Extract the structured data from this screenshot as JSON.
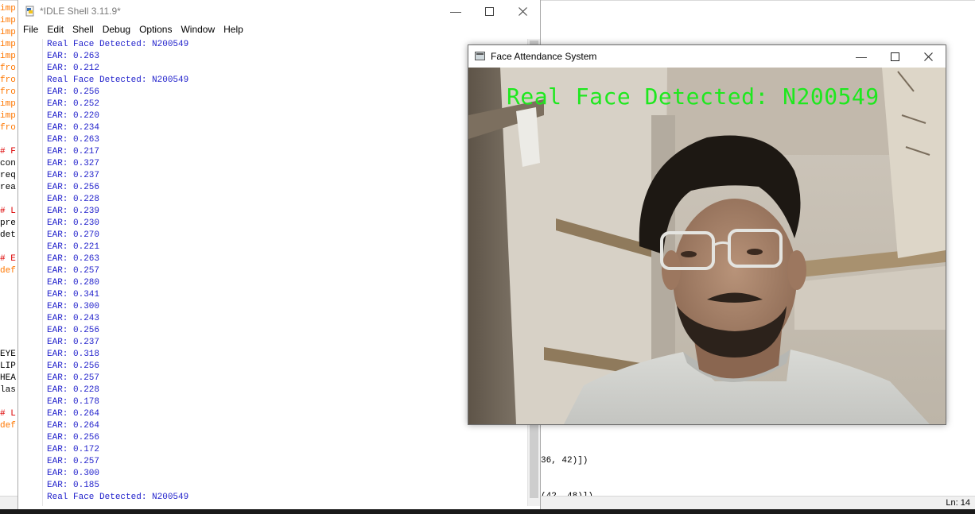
{
  "background_editor": {
    "code_lines": [
      {
        "text": "imp",
        "color": "#ff7700"
      },
      {
        "text": "imp",
        "color": "#ff7700"
      },
      {
        "text": "imp",
        "color": "#ff7700"
      },
      {
        "text": "imp",
        "color": "#ff7700"
      },
      {
        "text": "imp",
        "color": "#ff7700"
      },
      {
        "text": "fro",
        "color": "#ff7700"
      },
      {
        "text": "fro",
        "color": "#ff7700"
      },
      {
        "text": "fro",
        "color": "#ff7700"
      },
      {
        "text": "imp",
        "color": "#ff7700"
      },
      {
        "text": "imp",
        "color": "#ff7700"
      },
      {
        "text": "fro",
        "color": "#ff7700"
      },
      {
        "text": "",
        "color": "#000000"
      },
      {
        "text": "# F",
        "color": "#dd0000"
      },
      {
        "text": "con",
        "color": "#000000"
      },
      {
        "text": "req",
        "color": "#000000"
      },
      {
        "text": "rea",
        "color": "#000000"
      },
      {
        "text": "",
        "color": "#000000"
      },
      {
        "text": "# L",
        "color": "#dd0000"
      },
      {
        "text": "pre",
        "color": "#000000"
      },
      {
        "text": "det",
        "color": "#000000"
      },
      {
        "text": "",
        "color": "#000000"
      },
      {
        "text": "# E",
        "color": "#dd0000"
      },
      {
        "text": "def",
        "color": "#ff7700"
      },
      {
        "text": "",
        "color": "#000000"
      },
      {
        "text": "",
        "color": "#000000"
      },
      {
        "text": "",
        "color": "#000000"
      },
      {
        "text": "",
        "color": "#000000"
      },
      {
        "text": "",
        "color": "#000000"
      },
      {
        "text": "",
        "color": "#000000"
      },
      {
        "text": "EYE",
        "color": "#000000"
      },
      {
        "text": "LIP",
        "color": "#000000"
      },
      {
        "text": "HEA",
        "color": "#000000"
      },
      {
        "text": "las",
        "color": "#000000"
      },
      {
        "text": "",
        "color": "#000000"
      },
      {
        "text": "# L",
        "color": "#dd0000"
      },
      {
        "text": "def",
        "color": "#ff7700"
      }
    ],
    "right_code_lines": [
      "36, 42)])",
      "(42, 48)])"
    ],
    "status": "Ln: 14"
  },
  "idle": {
    "title": "*IDLE Shell 3.11.9*",
    "menu": [
      "File",
      "Edit",
      "Shell",
      "Debug",
      "Options",
      "Window",
      "Help"
    ],
    "output_lines": [
      "Real Face Detected: N200549",
      "EAR: 0.263",
      "EAR: 0.212",
      "Real Face Detected: N200549",
      "EAR: 0.256",
      "EAR: 0.252",
      "EAR: 0.220",
      "EAR: 0.234",
      "EAR: 0.263",
      "EAR: 0.217",
      "EAR: 0.327",
      "EAR: 0.237",
      "EAR: 0.256",
      "EAR: 0.228",
      "EAR: 0.239",
      "EAR: 0.230",
      "EAR: 0.270",
      "EAR: 0.221",
      "EAR: 0.263",
      "EAR: 0.257",
      "EAR: 0.280",
      "EAR: 0.341",
      "EAR: 0.300",
      "EAR: 0.243",
      "EAR: 0.256",
      "EAR: 0.237",
      "EAR: 0.318",
      "EAR: 0.256",
      "EAR: 0.257",
      "EAR: 0.228",
      "EAR: 0.178",
      "EAR: 0.264",
      "EAR: 0.264",
      "EAR: 0.256",
      "EAR: 0.172",
      "EAR: 0.257",
      "EAR: 0.300",
      "EAR: 0.185",
      "Real Face Detected: N200549"
    ]
  },
  "face_window": {
    "title": "Face Attendance System",
    "overlay_text": "Real Face Detected: N200549"
  },
  "colors": {
    "shell_output": "#2222cc",
    "overlay_text": "#1ee81e"
  }
}
